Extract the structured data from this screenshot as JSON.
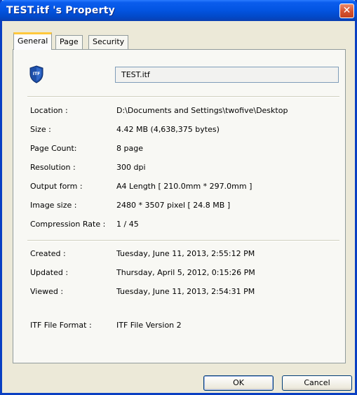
{
  "window": {
    "title": "TEST.itf 's Property",
    "close_symbol": "✕"
  },
  "tabs": [
    {
      "label": "General",
      "active": true
    },
    {
      "label": "Page",
      "active": false
    },
    {
      "label": "Security",
      "active": false
    }
  ],
  "file": {
    "icon": "itf-file-icon",
    "icon_text": "ITF",
    "name": "TEST.itf"
  },
  "general": [
    {
      "label": "Location :",
      "value": "D:\\Documents and Settings\\twofive\\Desktop"
    },
    {
      "label": "Size :",
      "value": "4.42 MB (4,638,375 bytes)"
    },
    {
      "label": "Page Count:",
      "value": "8 page"
    },
    {
      "label": "Resolution :",
      "value": "300 dpi"
    },
    {
      "label": "Output form :",
      "value": "A4 Length [ 210.0mm * 297.0mm ]"
    },
    {
      "label": "Image size :",
      "value": "2480 * 3507 pixel [ 24.8 MB ]"
    },
    {
      "label": "Compression Rate :",
      "value": "1 / 45"
    }
  ],
  "dates": [
    {
      "label": "Created :",
      "value": "Tuesday, June 11, 2013, 2:55:12 PM"
    },
    {
      "label": "Updated :",
      "value": "Thursday, April 5, 2012, 0:15:26 PM"
    },
    {
      "label": "Viewed :",
      "value": "Tuesday, June 11, 2013, 2:54:31 PM"
    }
  ],
  "format": {
    "label": "ITF File Format :",
    "value": "ITF File Version 2"
  },
  "buttons": {
    "ok": "OK",
    "cancel": "Cancel"
  },
  "colors": {
    "titlebar": "#0355e3",
    "close": "#d4512f",
    "tab_highlight": "#ffc83c",
    "dialog_bg": "#ece9d8"
  }
}
